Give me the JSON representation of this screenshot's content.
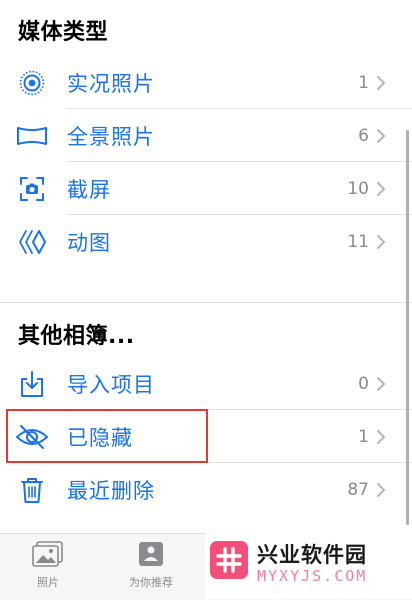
{
  "sections": {
    "media_types": {
      "title": "媒体类型",
      "items": [
        {
          "label": "实况照片",
          "count": "1",
          "icon": "live-photo-icon"
        },
        {
          "label": "全景照片",
          "count": "6",
          "icon": "panorama-icon"
        },
        {
          "label": "截屏",
          "count": "10",
          "icon": "screenshot-icon"
        },
        {
          "label": "动图",
          "count": "11",
          "icon": "animated-icon"
        }
      ]
    },
    "other_albums": {
      "title": "其他相簿...",
      "items": [
        {
          "label": "导入项目",
          "count": "0",
          "icon": "import-icon"
        },
        {
          "label": "已隐藏",
          "count": "1",
          "icon": "hidden-eye-icon"
        },
        {
          "label": "最近删除",
          "count": "87",
          "icon": "trash-icon"
        }
      ]
    }
  },
  "tabbar": {
    "photos_label": "照片",
    "for_you_label": "为你推荐"
  },
  "watermark": {
    "title": "兴业软件园",
    "url": "MYXYJS.COM"
  },
  "colors": {
    "accent": "#1a73e8",
    "count": "#8a8a8e",
    "highlight": "#e53935",
    "watermark_pink": "#f0507a"
  }
}
